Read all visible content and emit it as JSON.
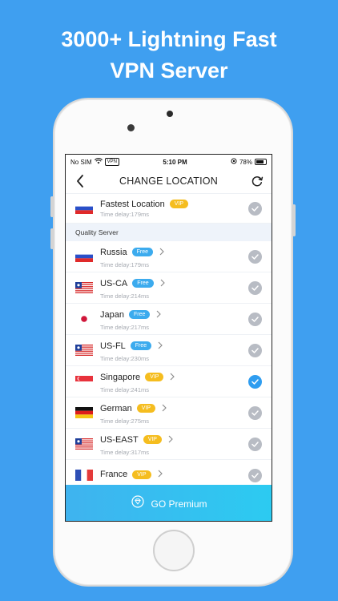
{
  "headline": {
    "line1": "3000+ Lightning Fast",
    "line2": "VPN Server"
  },
  "statusbar": {
    "carrier": "No SIM",
    "vpn": "VPN",
    "time": "5:10 PM",
    "battery": "78%"
  },
  "navbar": {
    "title": "CHANGE LOCATION",
    "back_icon": "chevron-left-icon",
    "refresh_icon": "refresh-icon"
  },
  "fastest": {
    "name": "Fastest Location",
    "badge": "VIP",
    "delay": "Time delay:179ms",
    "flag": "russia"
  },
  "section_title": "Quality Server",
  "servers": [
    {
      "name": "Russia",
      "badge": "Free",
      "delay": "Time delay:179ms",
      "flag": "russia",
      "selected": false
    },
    {
      "name": "US-CA",
      "badge": "Free",
      "delay": "Time delay:214ms",
      "flag": "liberia",
      "selected": false
    },
    {
      "name": "Japan",
      "badge": "Free",
      "delay": "Time delay:217ms",
      "flag": "japan",
      "selected": false
    },
    {
      "name": "US-FL",
      "badge": "Free",
      "delay": "Time delay:230ms",
      "flag": "liberia",
      "selected": false
    },
    {
      "name": "Singapore",
      "badge": "VIP",
      "delay": "Time delay:241ms",
      "flag": "singapore",
      "selected": true
    },
    {
      "name": "German",
      "badge": "VIP",
      "delay": "Time delay:275ms",
      "flag": "germany",
      "selected": false
    },
    {
      "name": "US-EAST",
      "badge": "VIP",
      "delay": "Time delay:317ms",
      "flag": "liberia",
      "selected": false
    },
    {
      "name": "France",
      "badge": "VIP",
      "delay": "",
      "flag": "france",
      "selected": false
    }
  ],
  "premium": {
    "label": "GO Premium",
    "icon": "diamond-icon"
  },
  "colors": {
    "background": "#3f9ff0",
    "vip": "#f5bd1f",
    "free": "#3cabee",
    "selected": "#2f9df0",
    "unselected": "#b8bcc4"
  }
}
